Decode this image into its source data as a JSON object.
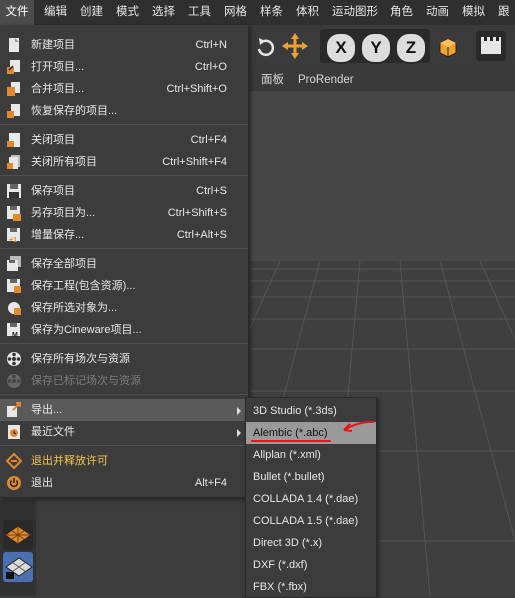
{
  "menubar": {
    "items": [
      "文件",
      "编辑",
      "创建",
      "模式",
      "选择",
      "工具",
      "网格",
      "样条",
      "体积",
      "运动图形",
      "角色",
      "动画",
      "模拟",
      "跟踪"
    ]
  },
  "toolbar": {
    "axis_labels": [
      "X",
      "Y",
      "Z"
    ]
  },
  "subbar": {
    "items": [
      "面板",
      "ProRender"
    ]
  },
  "file_menu": {
    "items": [
      {
        "label": "新建项目",
        "shortcut": "Ctrl+N"
      },
      {
        "label": "打开项目...",
        "shortcut": "Ctrl+O"
      },
      {
        "label": "合并项目...",
        "shortcut": "Ctrl+Shift+O"
      },
      {
        "label": "恢复保存的项目...",
        "shortcut": ""
      },
      {
        "label": "关闭项目",
        "shortcut": "Ctrl+F4"
      },
      {
        "label": "关闭所有项目",
        "shortcut": "Ctrl+Shift+F4"
      },
      {
        "label": "保存项目",
        "shortcut": "Ctrl+S"
      },
      {
        "label": "另存项目为...",
        "shortcut": "Ctrl+Shift+S"
      },
      {
        "label": "增量保存...",
        "shortcut": "Ctrl+Alt+S"
      },
      {
        "label": "保存全部项目",
        "shortcut": ""
      },
      {
        "label": "保存工程(包含资源)...",
        "shortcut": ""
      },
      {
        "label": "保存所选对象为...",
        "shortcut": ""
      },
      {
        "label": "保存为Cineware项目...",
        "shortcut": ""
      },
      {
        "label": "保存所有场次与资源",
        "shortcut": ""
      },
      {
        "label": "保存已标记场次与资源",
        "shortcut": "",
        "disabled": true
      },
      {
        "label": "导出...",
        "shortcut": "",
        "submenu": true,
        "highlighted": true
      },
      {
        "label": "最近文件",
        "shortcut": "",
        "submenu": true
      },
      {
        "label": "退出并释放许可",
        "shortcut": "",
        "yellow": true
      },
      {
        "label": "退出",
        "shortcut": "Alt+F4"
      }
    ]
  },
  "export_submenu": {
    "items": [
      {
        "label": "3D Studio (*.3ds)"
      },
      {
        "label": "Alembic (*.abc)",
        "highlighted": true
      },
      {
        "label": "Allplan (*.xml)"
      },
      {
        "label": "Bullet (*.bullet)"
      },
      {
        "label": "COLLADA 1.4 (*.dae)"
      },
      {
        "label": "COLLADA 1.5 (*.dae)"
      },
      {
        "label": "Direct 3D (*.x)"
      },
      {
        "label": "DXF (*.dxf)"
      },
      {
        "label": "FBX (*.fbx)"
      }
    ]
  },
  "colors": {
    "menu_bg": "#3c3c3c",
    "highlight": "#5a5a5a",
    "submenu_highlight": "#9a9a9a",
    "annotation_red": "#e11111",
    "yellow_text": "#f3c64b"
  }
}
